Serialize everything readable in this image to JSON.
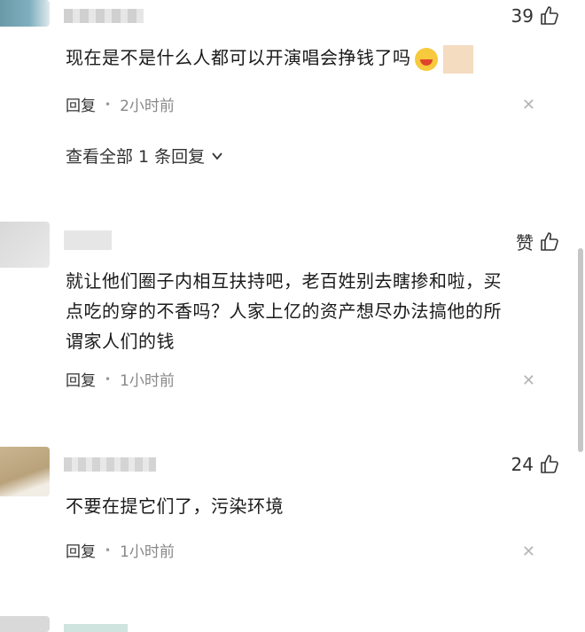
{
  "comments": [
    {
      "likes": "39",
      "text": "现在是不是什么人都可以开演唱会挣钱了吗",
      "reply_label": "回复",
      "time": "2小时前",
      "view_replies": "查看全部 1 条回复"
    },
    {
      "likes": "赞",
      "text_line1": "就让他们圈子内相互扶持吧，老百姓别去瞎掺和啦，买",
      "text_line2": "点吃的穿的不香吗？人家上亿的资产想尽办法搞他的所",
      "text_line3": "谓家人们的钱",
      "reply_label": "回复",
      "time": "1小时前"
    },
    {
      "likes": "24",
      "text": "不要在提它们了，污染环境",
      "reply_label": "回复",
      "time": "1小时前"
    }
  ],
  "colors": {
    "accent": "#222222",
    "muted": "#888888",
    "close": "#b5b5b5"
  },
  "icons": [
    "thumbs-up-icon",
    "close-icon",
    "chevron-down-icon",
    "laughing-emoji-icon"
  ]
}
